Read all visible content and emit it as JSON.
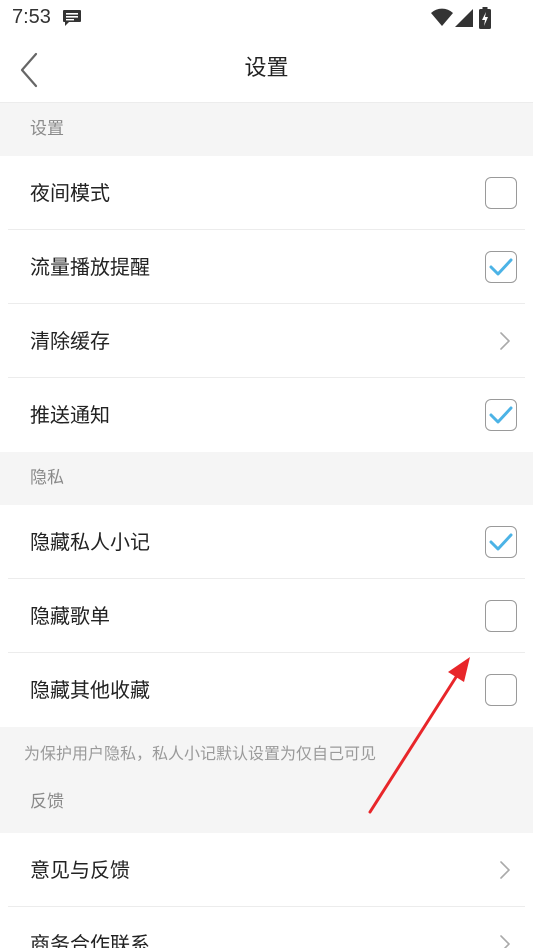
{
  "status_bar": {
    "time": "7:53",
    "icons": [
      "message-icon",
      "wifi-icon",
      "signal-icon",
      "battery-charging-icon"
    ]
  },
  "nav": {
    "title": "设置",
    "back_icon": "chevron-left-icon"
  },
  "sections": {
    "settings": {
      "header": "设置",
      "items": [
        {
          "label": "夜间模式",
          "control": "checkbox",
          "checked": false
        },
        {
          "label": "流量播放提醒",
          "control": "checkbox",
          "checked": true
        },
        {
          "label": "清除缓存",
          "control": "chevron"
        },
        {
          "label": "推送通知",
          "control": "checkbox",
          "checked": true
        }
      ]
    },
    "privacy": {
      "header": "隐私",
      "items": [
        {
          "label": "隐藏私人小记",
          "control": "checkbox",
          "checked": true
        },
        {
          "label": "隐藏歌单",
          "control": "checkbox",
          "checked": false
        },
        {
          "label": "隐藏其他收藏",
          "control": "checkbox",
          "checked": false
        }
      ],
      "note": "为保护用户隐私，私人小记默认设置为仅自己可见"
    },
    "feedback": {
      "header": "反馈",
      "items": [
        {
          "label": "意见与反馈",
          "control": "chevron"
        },
        {
          "label": "商务合作联系",
          "control": "chevron"
        }
      ]
    }
  },
  "colors": {
    "accent_check": "#4cb3e6",
    "section_bg": "#f5f5f5",
    "annotation_arrow": "#e8262a"
  }
}
